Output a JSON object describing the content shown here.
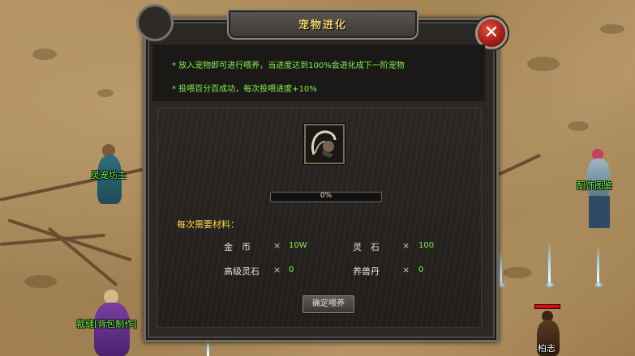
{
  "dialog": {
    "title": "宠物进化",
    "close_label": "✕",
    "info_lines": [
      "* 放入宠物即可进行喂养，当进度达到100%会进化成下一阶宠物",
      "* 投喂百分百成功，每次投喂进度+10%"
    ],
    "progress": {
      "value": 0,
      "text": "0%"
    },
    "requirements_title": "每次需要材料：",
    "materials": [
      {
        "name": "金　币",
        "x": "×",
        "qty": "10W"
      },
      {
        "name": "灵　石",
        "x": "×",
        "qty": "100"
      },
      {
        "name": "高级灵石",
        "x": "×",
        "qty": "0"
      },
      {
        "name": "养兽丹",
        "x": "×",
        "qty": "0"
      }
    ],
    "confirm_label": "确定喂养"
  },
  "npcs": {
    "pet_master": "灵宠坊主",
    "tailor": "裁缝[背包制作]",
    "accessory": "配饰图鉴",
    "player": "柏志"
  },
  "colors": {
    "accent_title": "#f1d36b",
    "info_green": "#7ff04a",
    "npc_green": "#6cff4a",
    "close_red": "#c02a18"
  }
}
